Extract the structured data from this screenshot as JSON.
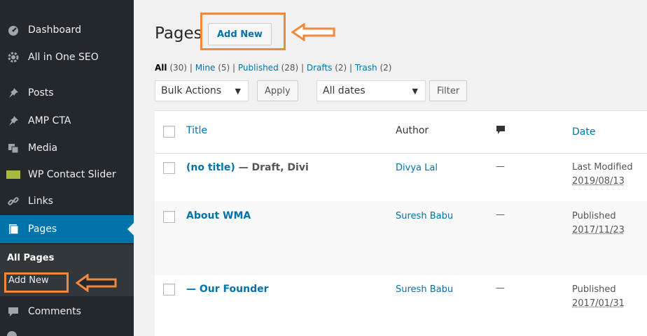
{
  "sidebar": {
    "items": [
      {
        "label": "Dashboard",
        "icon": "dashboard-icon"
      },
      {
        "label": "All in One SEO",
        "icon": "gear-icon"
      },
      {
        "label": "Posts",
        "icon": "pin-icon"
      },
      {
        "label": "AMP CTA",
        "icon": "pin-icon"
      },
      {
        "label": "Media",
        "icon": "media-icon"
      },
      {
        "label": "WP Contact Slider",
        "icon": "slider-icon"
      },
      {
        "label": "Links",
        "icon": "link-icon"
      },
      {
        "label": "Pages",
        "icon": "page-icon"
      },
      {
        "label": "Comments",
        "icon": "comment-icon"
      }
    ],
    "submenu": {
      "all_pages": "All Pages",
      "add_new": "Add New"
    }
  },
  "main": {
    "title": "Pages",
    "add_new": "Add New",
    "filters": {
      "all": "All",
      "all_count": "(30)",
      "mine": "Mine",
      "mine_count": "(5)",
      "published": "Published",
      "published_count": "(28)",
      "drafts": "Drafts",
      "drafts_count": "(2)",
      "trash": "Trash",
      "trash_count": "(2)",
      "separator": "|"
    },
    "bulk_actions": "Bulk Actions",
    "apply": "Apply",
    "all_dates": "All dates",
    "filter": "Filter",
    "columns": {
      "title": "Title",
      "author": "Author",
      "date": "Date"
    },
    "rows": [
      {
        "title": "(no title)",
        "state": " — Draft, Divi",
        "author": "Divya Lal",
        "comments": "—",
        "date_status": "Last Modified",
        "date": "2019/08/13"
      },
      {
        "title": "About WMA",
        "state": "",
        "author": "Suresh Babu",
        "comments": "—",
        "date_status": "Published",
        "date": "2017/11/23"
      },
      {
        "title": "— Our Founder",
        "state": "",
        "author": "Suresh Babu",
        "comments": "—",
        "date_status": "Published",
        "date": "2017/01/31"
      }
    ]
  },
  "colors": {
    "sidebar_bg": "#23282d",
    "active_bg": "#0073aa",
    "link": "#0073aa",
    "highlight": "#f0883e"
  }
}
